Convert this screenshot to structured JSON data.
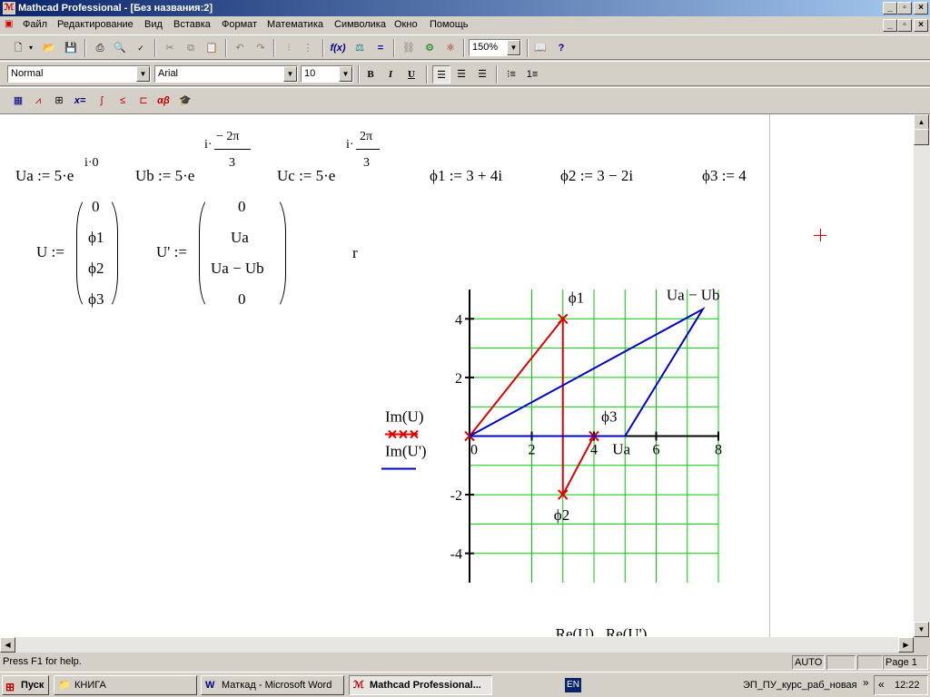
{
  "window": {
    "title": "Mathcad Professional - [Без названия:2]"
  },
  "menu": [
    "Файл",
    "Редактирование",
    "Вид",
    "Вставка",
    "Формат",
    "Математика",
    "Символика",
    "Окно",
    "Помощь"
  ],
  "format_bar": {
    "style": "Normal",
    "font": "Arial",
    "size": "10",
    "bold": "B",
    "italic": "I",
    "underline": "U"
  },
  "std_bar": {
    "zoom": "150%"
  },
  "math_bar": {
    "eval": "x=",
    "greek": "αβ"
  },
  "sheet": {
    "ua_def": "Ua := 5·e",
    "ua_exp": "i·0",
    "ub_def": "Ub := 5·e",
    "ub_exp_i": "i·",
    "ub_exp_num": "− 2π",
    "ub_exp_den": "3",
    "uc_def": "Uc := 5·e",
    "uc_exp_i": "i·",
    "uc_exp_num": "2π",
    "uc_exp_den": "3",
    "phi1_def": "ϕ1 := 3 + 4i",
    "phi2_def": "ϕ2 := 3 − 2i",
    "phi3_def": "ϕ3 := 4",
    "U_label": "U :=",
    "U_items": [
      "0",
      "ϕ1",
      "ϕ2",
      "ϕ3"
    ],
    "Up_label": "U' :=",
    "Up_items": [
      "0",
      "Ua",
      "Ua − Ub",
      "0"
    ],
    "r": "r"
  },
  "chart_data": {
    "type": "scatter",
    "xlim": [
      0,
      8
    ],
    "ylim": [
      -5,
      5
    ],
    "xticks": [
      "0",
      "2",
      "4",
      "6",
      "8"
    ],
    "yticks": [
      "4",
      "2",
      "-2",
      "-4"
    ],
    "grid": true,
    "xlabel": "Re(U) , Re(U')",
    "legend": [
      "Im(U)",
      "Im(U')"
    ],
    "series": [
      {
        "name": "Im(U)",
        "color": "#e00000",
        "marker": "x",
        "points": [
          [
            0,
            0
          ],
          [
            3,
            4
          ],
          [
            3,
            -2
          ],
          [
            4,
            0
          ]
        ]
      },
      {
        "name": "Im(U')",
        "color": "#0000cc",
        "marker": "none",
        "points": [
          [
            0,
            0
          ],
          [
            5,
            0
          ],
          [
            7.5,
            4.33
          ],
          [
            0,
            0
          ]
        ]
      }
    ],
    "annotations": [
      {
        "text": "ϕ1",
        "x": 3,
        "y": 4
      },
      {
        "text": "Ua − Ub",
        "x": 7.5,
        "y": 4.33
      },
      {
        "text": "ϕ3",
        "x": 4,
        "y": 0
      },
      {
        "text": "Ua",
        "x": 5,
        "y": 0
      },
      {
        "text": "ϕ2",
        "x": 3,
        "y": -2
      }
    ]
  },
  "status": {
    "help": "Press F1 for help.",
    "mode": "AUTO",
    "page": "Page 1"
  },
  "taskbar": {
    "start": "Пуск",
    "tasks": [
      "КНИГА",
      "Маткад - Microsoft Word",
      "Mathcad Professional..."
    ],
    "lang": "EN",
    "tray_text": "ЭП_ПУ_курс_раб_новая",
    "clock": "12:22"
  },
  "colors": {
    "title_start": "#0a246a",
    "title_end": "#a6caf0",
    "grid": "#00cc00",
    "series_u": "#e00000",
    "series_up": "#0000cc"
  }
}
